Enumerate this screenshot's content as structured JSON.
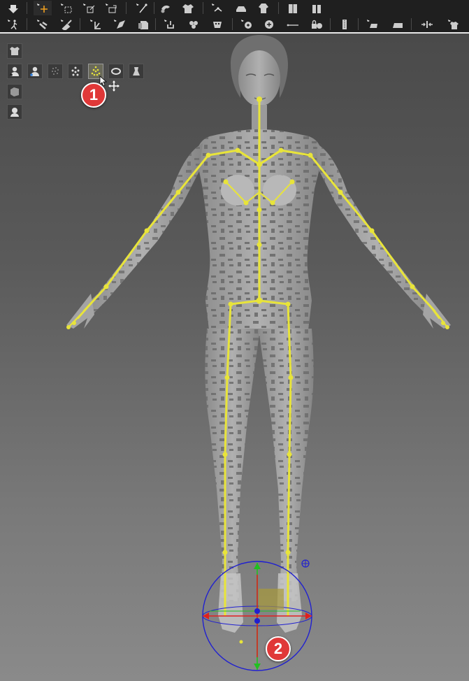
{
  "toolbar": {
    "row1_icons": [
      "down-arrow-icon",
      "move-tool-icon",
      "box-select-icon",
      "scale-tool-icon",
      "rotate-tool-icon",
      "bone-draw-icon",
      "hand-icon",
      "shirt-icon",
      "joints-icon",
      "car-icon",
      "hoodie-icon",
      "wardrobe-icon",
      "split-shirt-icon"
    ],
    "row2_icons": [
      "walking-figure-icon",
      "pose-tool-icon",
      "paint-brush-icon",
      "axis-tool-icon",
      "fold-tool-icon",
      "tag-tool-icon",
      "link-tool-icon",
      "flower-icon",
      "mask-tool-icon",
      "node-add-icon",
      "node-icon",
      "line-tool-icon",
      "lock-icon",
      "zipper-icon",
      "flat-tool-icon",
      "flat-alt-icon",
      "slide-icon",
      "shirt-arrow-icon"
    ]
  },
  "viewport": {
    "callouts": [
      {
        "label": "1"
      },
      {
        "label": "2"
      }
    ],
    "panel_icons": [
      "garment-icon",
      "avatar-icon",
      "avatar-select-icon",
      "point-cloud-icon",
      "skeleton-points-icon",
      "skeleton-icon",
      "measure-icon",
      "dress-form-icon",
      "surface-icon",
      "head-avatar-icon"
    ]
  },
  "colors": {
    "skeleton": "#e8e43a",
    "gizmo_x": "#e02020",
    "gizmo_y": "#20c020",
    "gizmo_ring": "#2020d0",
    "badge": "#e03838"
  }
}
